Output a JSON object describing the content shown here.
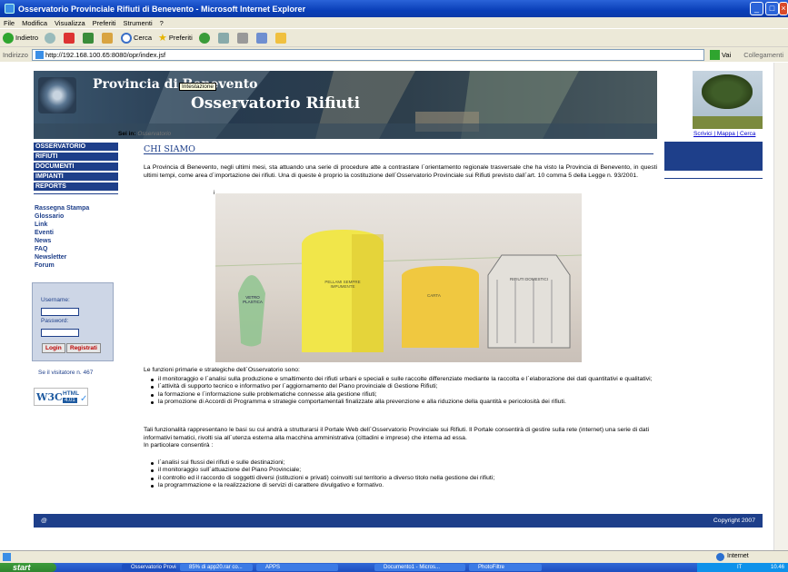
{
  "window": {
    "title": "Osservatorio Provinciale Rifiuti di Benevento - Microsoft Internet Explorer"
  },
  "menu": [
    "File",
    "Modifica",
    "Visualizza",
    "Preferiti",
    "Strumenti",
    "?"
  ],
  "toolbar": {
    "back": "Indietro",
    "search": "Cerca",
    "favorites": "Preferiti"
  },
  "address": {
    "label": "Indirizzo",
    "url": "http://192.168.100.65:8080/opr/index.jsf",
    "go": "Vai",
    "links": "Collegamenti"
  },
  "banner": {
    "line1": "Provincia di Benevento",
    "line2": "Osservatorio Rifiuti",
    "tooltip": "Intestazione"
  },
  "breadcrumb": {
    "prefix": "Sei in:",
    "current": "Osservatorio"
  },
  "toplinks": "Scrivici | Mappa | Cerca",
  "nav": [
    "OSSERVATORIO",
    "RIFIUTI",
    "DOCUMENTI",
    "IMPIANTI",
    "REPORTS"
  ],
  "sidelinks": [
    "Rassegna Stampa",
    "Glossario",
    "Link",
    "Eventi",
    "News",
    "FAQ",
    "Newsletter",
    "Forum"
  ],
  "login": {
    "username_label": "Username:",
    "password_label": "Password:",
    "login_btn": "Login",
    "register_btn": "Registrati"
  },
  "visitors": "Se il visitatore n. 467",
  "w3c": {
    "logo": "W3C",
    "html": "HTML",
    "version": "4.01"
  },
  "main": {
    "heading": "CHI SIAMO",
    "intro": "La Provincia di Benevento, negli ultimi mesi, sta attuando una serie di procedure atte a contrastare l´orientamento regionale trasversale che ha visto la Provincia di Benevento, in questi ultimi tempi, come area d´importazione dei rifiuti. Una di queste è proprio la costituzione dell´Osservatorio Provinciale sui Rifiuti previsto dall´art. 10 comma 5 della Legge n. 93/2001.",
    "drawing_caption": "i",
    "bins": [
      "VETRO PLASTICA",
      "PELLAMI SEMPRE IMPUMENTE",
      "CARTA",
      "RIFIUTI DOMESTICI"
    ],
    "functions_intro": "Le funzioni primarie e strategiche dell´Osservatorio sono:",
    "functions": [
      "il monitoraggio e l´analisi sulla produzione e smaltimento dei rifiuti urbani e speciali e sulle raccolte differenziate mediante la raccolta e l´elaborazione dei dati quantitativi e qualitativi;",
      "l´attività di supporto tecnico e informativo per l´aggiornamento del Piano provinciale di Gestione Rifiuti;",
      "la formazione e l´informazione sulle problematiche connesse alla gestione rifiuti;",
      "la promozione di Accordi di Programma e strategie comportamentali finalizzate alla prevenzione e alla riduzione della quantità e pericolosità dei rifiuti."
    ],
    "portal": "Tali funzionalità rappresentano le basi su cui andrà a strutturarsi il Portale Web dell´Osservatorio Provinciale sui Rifiuti. Il Portale consentirà di gestire sulla rete (internet) una serie di dati informativi tematici, rivolti sia all´utenza esterna alla macchina amministrativa (cittadini e imprese) che interna ad essa.",
    "portal_intro": "In particolare consentirà :",
    "portal_items": [
      "l´analisi sui flussi dei rifiuti e sulle destinazioni;",
      "il monitoraggio sull´attuazione del Piano Provinciale;",
      "il controllo ed il raccordo di soggetti diversi (istituzioni e privati) coinvolti sul territorio a diverso titolo nella gestione dei rifiuti;",
      "la programmazione e la realizzazione di servizi di carattere divulgativo e formativo."
    ]
  },
  "footer": {
    "left": "@",
    "right": "Copyright 2007"
  },
  "status": {
    "zone": "Internet"
  },
  "taskbar": {
    "start": "start",
    "tasks": [
      "Osservatorio Provinci...",
      "85% di app20.rar co...",
      "APPS",
      "Documento1 - Micros...",
      "PhotoFiltre"
    ],
    "locale": "IT",
    "clock": "10.46"
  },
  "colors": {
    "navy": "#1e3f8a",
    "titlebar": "#0a3fb8",
    "link": "#0000cc"
  }
}
